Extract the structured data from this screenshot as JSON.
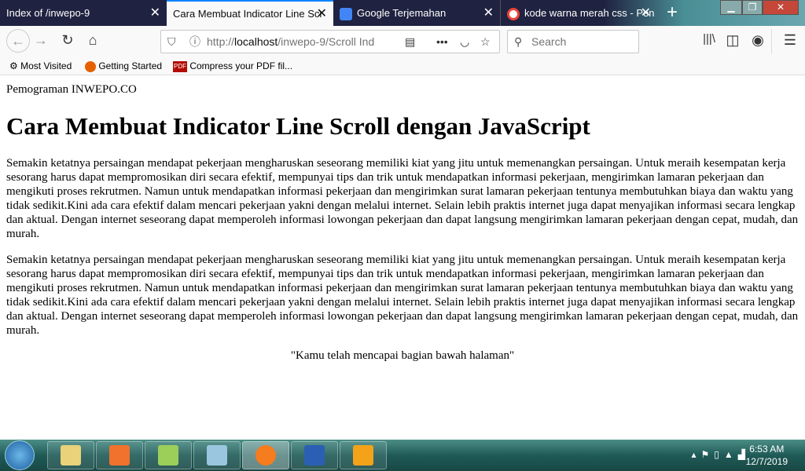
{
  "tabs": [
    {
      "title": "Index of /inwepo-9",
      "active": false
    },
    {
      "title": "Cara Membuat Indicator Line Scr",
      "active": true
    },
    {
      "title": "Google Terjemahan",
      "active": false
    },
    {
      "title": "kode warna merah css - Pen",
      "active": false
    }
  ],
  "toolbar": {
    "url_prefix": "http://",
    "url_host": "localhost",
    "url_path": "/inwepo-9/Scroll Ind",
    "search_placeholder": "Search"
  },
  "bookmarks": [
    "Most Visited",
    "Getting Started",
    "Compress your PDF fil..."
  ],
  "page": {
    "brand": "Pemograman INWEPO.CO",
    "title": "Cara Membuat Indicator Line Scroll dengan JavaScript",
    "paragraphs": [
      "Semakin ketatnya persaingan mendapat pekerjaan mengharuskan seseorang memiliki kiat yang jitu untuk memenangkan persaingan. Untuk meraih kesempatan kerja sesorang harus dapat mempromosikan diri secara efektif, mempunyai tips dan trik untuk mendapatkan informasi pekerjaan, mengirimkan lamaran pekerjaan dan mengikuti proses rekrutmen. Namun untuk mendapatkan informasi pekerjaan dan mengirimkan surat lamaran pekerjaan tentunya membutuhkan biaya dan waktu yang tidak sedikit.Kini ada cara efektif dalam mencari pekerjaan yakni dengan melalui internet. Selain lebih praktis internet juga dapat menyajikan informasi secara lengkap dan aktual. Dengan internet seseorang dapat memperoleh informasi lowongan pekerjaan dan dapat langsung mengirimkan lamaran pekerjaan dengan cepat, mudah, dan murah.",
      "Semakin ketatnya persaingan mendapat pekerjaan mengharuskan seseorang memiliki kiat yang jitu untuk memenangkan persaingan. Untuk meraih kesempatan kerja sesorang harus dapat mempromosikan diri secara efektif, mempunyai tips dan trik untuk mendapatkan informasi pekerjaan, mengirimkan lamaran pekerjaan dan mengikuti proses rekrutmen. Namun untuk mendapatkan informasi pekerjaan dan mengirimkan surat lamaran pekerjaan tentunya membutuhkan biaya dan waktu yang tidak sedikit.Kini ada cara efektif dalam mencari pekerjaan yakni dengan melalui internet. Selain lebih praktis internet juga dapat menyajikan informasi secara lengkap dan aktual. Dengan internet seseorang dapat memperoleh informasi lowongan pekerjaan dan dapat langsung mengirimkan lamaran pekerjaan dengan cepat, mudah, dan murah."
    ],
    "end_text": "\"Kamu telah mencapai bagian bawah halaman\""
  },
  "taskbar": {
    "time": "6:53 AM",
    "date": "12/7/2019"
  }
}
